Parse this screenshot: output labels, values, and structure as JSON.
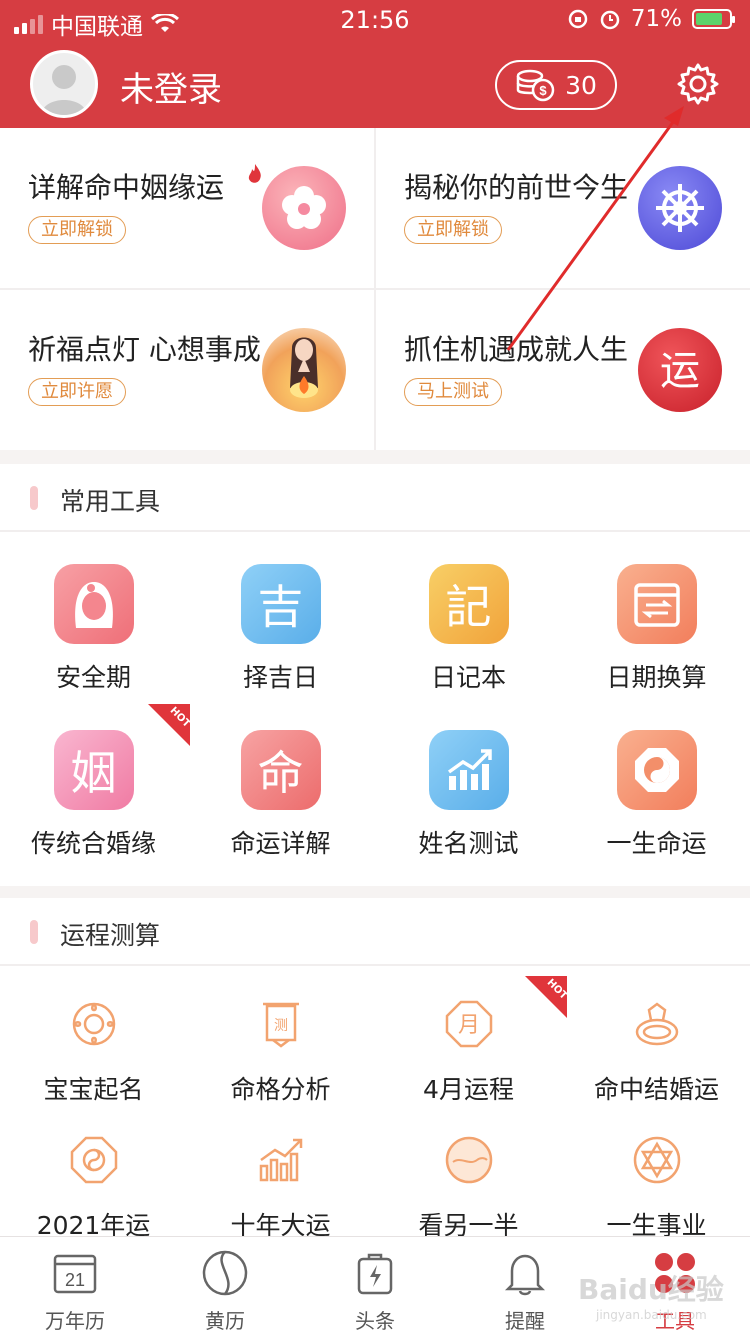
{
  "status": {
    "carrier": "中国联通",
    "time": "21:56",
    "battery": "71%"
  },
  "header": {
    "login_text": "未登录",
    "coins": "30"
  },
  "cards": [
    {
      "title": "详解命中姻缘运",
      "tag": "立即解锁",
      "icon": "flower-icon"
    },
    {
      "title": "揭秘你的前世今生",
      "tag": "立即解锁",
      "icon": "wheel-icon"
    },
    {
      "title": "祈福点灯 心想事成",
      "tag": "立即许愿",
      "icon": "lamp-icon"
    },
    {
      "title": "抓住机遇成就人生",
      "tag": "马上测试",
      "icon": "fortune-icon"
    }
  ],
  "tools": {
    "title": "常用工具",
    "items": [
      {
        "label": "安全期",
        "glyph": "",
        "color1": "#f7a0a5",
        "color2": "#ef6f78"
      },
      {
        "label": "择吉日",
        "glyph": "吉",
        "color1": "#8fd0f7",
        "color2": "#5aaee9"
      },
      {
        "label": "日记本",
        "glyph": "記",
        "color1": "#f8cf66",
        "color2": "#f1a33b"
      },
      {
        "label": "日期换算",
        "glyph": "",
        "color1": "#f9b08f",
        "color2": "#f27e5c"
      },
      {
        "label": "传统合婚缘",
        "glyph": "姻",
        "color1": "#f9b6d0",
        "color2": "#f07ba3",
        "hot": "HOT"
      },
      {
        "label": "命运详解",
        "glyph": "命",
        "color1": "#f7a3a3",
        "color2": "#ec6c6c"
      },
      {
        "label": "姓名测试",
        "glyph": "",
        "color1": "#8fd0f7",
        "color2": "#5aaee9"
      },
      {
        "label": "一生命运",
        "glyph": "",
        "color1": "#f9b08f",
        "color2": "#f27e5c"
      }
    ]
  },
  "fortune": {
    "title": "运程测算",
    "items": [
      {
        "label": "宝宝起名",
        "icon": "baby-name-icon"
      },
      {
        "label": "命格分析",
        "icon": "scroll-icon"
      },
      {
        "label": "4月运程",
        "icon": "month-icon",
        "hot": "HOT"
      },
      {
        "label": "命中结婚运",
        "icon": "ring-icon"
      },
      {
        "label": "2021年运",
        "icon": "bagua-icon"
      },
      {
        "label": "十年大运",
        "icon": "chart-up-icon"
      },
      {
        "label": "看另一半",
        "icon": "moon-icon"
      },
      {
        "label": "一生事业",
        "icon": "star-icon"
      }
    ]
  },
  "tabbar": [
    {
      "label": "万年历",
      "icon": "calendar-icon",
      "day": "21"
    },
    {
      "label": "黄历",
      "icon": "yinyang-icon"
    },
    {
      "label": "头条",
      "icon": "bag-icon"
    },
    {
      "label": "提醒",
      "icon": "bell-icon"
    },
    {
      "label": "工具",
      "icon": "tools-icon",
      "active": true
    }
  ],
  "watermark": {
    "text": "Baidu经验",
    "sub": "jingyan.baidu.com"
  },
  "colors": {
    "brand": "#d63d42",
    "tag": "#e08a3d",
    "icon_orange": "#f2a36f"
  }
}
